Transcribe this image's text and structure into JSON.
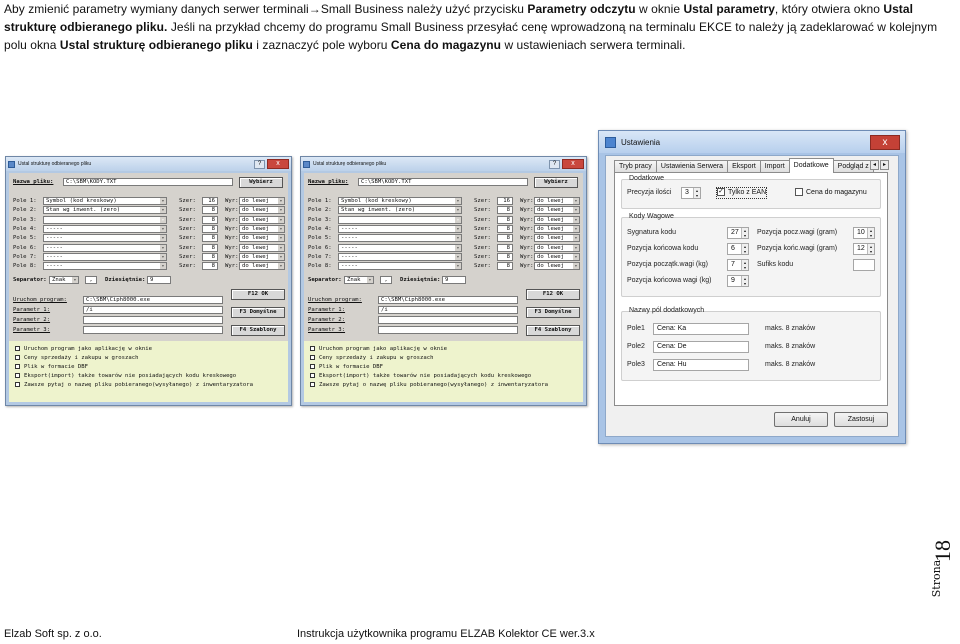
{
  "intro": {
    "t1": "Aby zmienić parametry wymiany danych serwer terminali",
    "arrow": "→",
    "t2": "Small Business należy użyć przycisku ",
    "b1": "Parametry odczytu",
    "t3": " w oknie ",
    "b2": "Ustal parametry",
    "t4": ", który otwiera okno ",
    "b3": "Ustal strukturę odbieranego pliku.",
    "t5": " Jeśli na przykład chcemy do programu Small Business przesyłać cenę wprowadzoną na terminalu EKCE to należy ją zadeklarować w kolejnym polu okna ",
    "b4": "Ustal strukturę odbieranego pliku",
    "t6": " i zaznaczyć pole wyboru ",
    "b5": "Cena do magazynu",
    "t7": " w ustawieniach serwera terminali."
  },
  "struct_dialogs": [
    {
      "title": "Ustal strukturę odbieranego pliku",
      "help": "?",
      "close": "x",
      "file_label": "Nazwa pliku:",
      "file_value": "C:\\SBM\\KODY.TXT",
      "choose": "Wybierz",
      "fields": [
        {
          "label": "Pole 1:",
          "value": "Symbol (kod kreskowy)",
          "width_label": "Szer:",
          "width": "16",
          "align_label": "Wyr:",
          "align": "do lewej"
        },
        {
          "label": "Pole 2:",
          "value": "Stan wg inwent. (zero)",
          "width_label": "Szer:",
          "width": "8",
          "align_label": "Wyr:",
          "align": "do lewej"
        },
        {
          "label": "Pole 3:",
          "value": "-----",
          "width_label": "Szer:",
          "width": "8",
          "align_label": "Wyr:",
          "align": "do lewej"
        },
        {
          "label": "Pole 4:",
          "value": "-----",
          "width_label": "Szer:",
          "width": "8",
          "align_label": "Wyr:",
          "align": "do lewej"
        },
        {
          "label": "Pole 5:",
          "value": "-----",
          "width_label": "Szer:",
          "width": "8",
          "align_label": "Wyr:",
          "align": "do lewej"
        },
        {
          "label": "Pole 6:",
          "value": "-----",
          "width_label": "Szer:",
          "width": "8",
          "align_label": "Wyr:",
          "align": "do lewej"
        },
        {
          "label": "Pole 7:",
          "value": "-----",
          "width_label": "Szer:",
          "width": "8",
          "align_label": "Wyr:",
          "align": "do lewej"
        },
        {
          "label": "Pole 8:",
          "value": "-----",
          "width_label": "Szer:",
          "width": "8",
          "align_label": "Wyr:",
          "align": "do lewej"
        }
      ],
      "sep_label": "Separator:",
      "sep_value": "Znak",
      "sep_char": ",",
      "dec_label": "Dziesiętnie:",
      "dec_value": "9",
      "run_label": "Uruchom program:",
      "run_value": "C:\\SBM\\Ciph8000.exe",
      "param1_label": "Parametr 1:",
      "param1_value": "/i",
      "param2_label": "Parametr 2:",
      "param2_value": "",
      "param3_label": "Parametr 3:",
      "param3_value": "",
      "btn_ok": "F12 OK",
      "btn_default": "F3 Domyślne",
      "btn_templates": "F4 Szablony",
      "checks": [
        "Uruchom program jako aplikację w oknie",
        "Ceny sprzedaży i zakupu w groszach",
        "Plik w formacie DBF",
        "Eksport(import) także towarów nie posiadających kodu kreskowego",
        "Zawsze pytaj o nazwę pliku pobieranego(wysyłanego) z inwentaryzatora"
      ]
    },
    {
      "title": "Ustal strukturę odbieranego pliku",
      "help": "?",
      "close": "x",
      "file_label": "Nazwa pliku:",
      "file_value": "C:\\SBM\\KODY.TXT",
      "choose": "Wybierz",
      "fields": [
        {
          "label": "Pole 1:",
          "value": "Symbol (kod kreskowy)",
          "width_label": "Szer:",
          "width": "16",
          "align_label": "Wyr:",
          "align": "do lewej"
        },
        {
          "label": "Pole 2:",
          "value": "Stan wg inwent. (zero)",
          "width_label": "Szer:",
          "width": "8",
          "align_label": "Wyr:",
          "align": "do lewej"
        },
        {
          "label": "Pole 3:",
          "value": "Cena brutto",
          "width_label": "Szer:",
          "width": "8",
          "align_label": "Wyr:",
          "align": "do lewej"
        },
        {
          "label": "Pole 4:",
          "value": "-----",
          "width_label": "Szer:",
          "width": "8",
          "align_label": "Wyr:",
          "align": "do lewej"
        },
        {
          "label": "Pole 5:",
          "value": "-----",
          "width_label": "Szer:",
          "width": "8",
          "align_label": "Wyr:",
          "align": "do lewej"
        },
        {
          "label": "Pole 6:",
          "value": "-----",
          "width_label": "Szer:",
          "width": "8",
          "align_label": "Wyr:",
          "align": "do lewej"
        },
        {
          "label": "Pole 7:",
          "value": "-----",
          "width_label": "Szer:",
          "width": "8",
          "align_label": "Wyr:",
          "align": "do lewej"
        },
        {
          "label": "Pole 8:",
          "value": "-----",
          "width_label": "Szer:",
          "width": "8",
          "align_label": "Wyr:",
          "align": "do lewej"
        }
      ],
      "sep_label": "Separator:",
      "sep_value": "Znak",
      "sep_char": ",",
      "dec_label": "Dziesiętnie:",
      "dec_value": "9",
      "run_label": "Uruchom program:",
      "run_value": "C:\\SBM\\Ciph8000.exe",
      "param1_label": "Parametr 1:",
      "param1_value": "/i",
      "param2_label": "Parametr 2:",
      "param2_value": "",
      "param3_label": "Parametr 3:",
      "param3_value": "",
      "btn_ok": "F12 OK",
      "btn_default": "F3 Domyślne",
      "btn_templates": "F4 Szablony",
      "checks": [
        "Uruchom program jako aplikację w oknie",
        "Ceny sprzedaży i zakupu w groszach",
        "Plik w formacie DBF",
        "Eksport(import) także towarów nie posiadających kodu kreskowego",
        "Zawsze pytaj o nazwę pliku pobieranego(wysyłanego) z inwentaryzatora"
      ]
    }
  ],
  "settings": {
    "title": "Ustawienia",
    "close": "x",
    "tabs": [
      "Tryb pracy",
      "Ustawienia Serwera",
      "Eksport",
      "Import",
      "Dodatkowe",
      "Podgląd z"
    ],
    "active_tab": "Dodatkowe",
    "dodatkowe_group": "Dodatkowe",
    "precision_label": "Precyzja ilości",
    "precision_value": "3",
    "only_ean": "Tylko z EAN",
    "only_ean_checked": true,
    "price_to_store": "Cena do magazynu",
    "price_to_store_checked": false,
    "codes_group": "Kody Wagowe",
    "signature_label": "Sygnatura kodu",
    "signature_value": "27",
    "pos_start_label": "Pozycja pocz.wagi (gram)",
    "pos_start_value": "10",
    "end_pos_label": "Pozycja końcowa kodu",
    "end_pos_value": "6",
    "pos_end_label": "Pozycja końc.wagi (gram)",
    "pos_end_value": "12",
    "start_kg_label": "Pozycja początk.wagi (kg)",
    "start_kg_value": "7",
    "suffix_label": "Sufiks kodu",
    "suffix_value": "",
    "end_kg_label": "Pozycja końcowa wagi (kg)",
    "end_kg_value": "9",
    "names_group": "Nazwy pól dodatkowych",
    "fields": [
      {
        "label": "Pole1",
        "value": "Cena: Ka",
        "max": "maks. 8 znaków"
      },
      {
        "label": "Pole2",
        "value": "Cena: De",
        "max": "maks. 8 znaków"
      },
      {
        "label": "Pole3",
        "value": "Cena: Hu",
        "max": "maks. 8 znaków"
      }
    ],
    "cancel": "Anuluj",
    "save": "Zastosuj"
  },
  "footer": {
    "company": "Elzab Soft sp. z o.o.",
    "doc": "Instrukcja użytkownika programu ELZAB Kolektor CE wer.3.x",
    "page_word": "Strona",
    "page_number": "18"
  }
}
